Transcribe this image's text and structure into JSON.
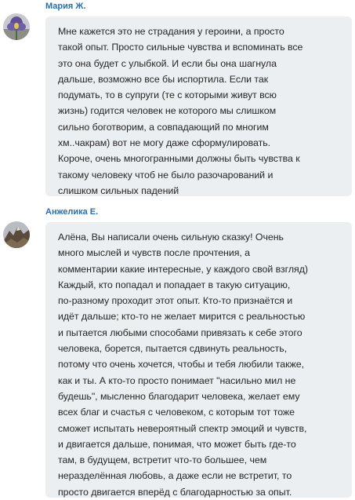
{
  "comments": [
    {
      "author": "Мария Ж.",
      "avatar_icon": "iris-flower-photo-avatar",
      "lines": [
        "Мне кажется это не страдания у героини, а просто",
        "такой опыт. Просто сильные чувства и вспоминать все",
        "это она будет с улыбкой.  И если бы она шагнула",
        "дальше, возможно все бы испортила. Если так",
        "подумать, то в супруги (те с которыми живут всю",
        "жизнь)  годится человек не которого мы слишком",
        "сильно боготворим, а совпадающий по многим",
        "хм..чакрам) вот не могу даже сформулировать.",
        "Короче, очень многогранными должны быть чувства к",
        "такому человеку чтоб не было разочарований и",
        "слишком сильных падений"
      ]
    },
    {
      "author": "Анжелика Е.",
      "avatar_icon": "mountain-landscape-avatar",
      "lines": [
        "Алёна, Вы написали очень сильную сказку! Очень",
        "много мыслей и чувств после прочтения, а",
        "комментарии какие интересные, у каждого свой взгляд)",
        "Каждый, кто попадал и попадает в такую ситуацию,",
        "по-разному проходит этот опыт. Кто-то признаётся и",
        "идёт дальше; кто-то не желает мирится с реальностью",
        "и пытается любыми способами привязать к себе этого",
        "человека, борется, пытается сдвинуть реальность,",
        "потому что очень хочется, чтобы и тебя любили также,",
        "как и ты. А кто-то просто понимает \"насильно мил не",
        "будешь\", мысленно благодарит человека, желает ему",
        "всех благ и счастья с человеком, с которым тот тоже",
        "сможет испытать невероятный спектр эмоций и чувств,",
        "и двигается дальше, понимая, что может быть где-то",
        "там, в будущем, встретит что-то большее, чем",
        "неразделённая любовь, а даже если не встретит, то",
        "просто двигается вперёд с благодарностью за опыт."
      ]
    }
  ]
}
